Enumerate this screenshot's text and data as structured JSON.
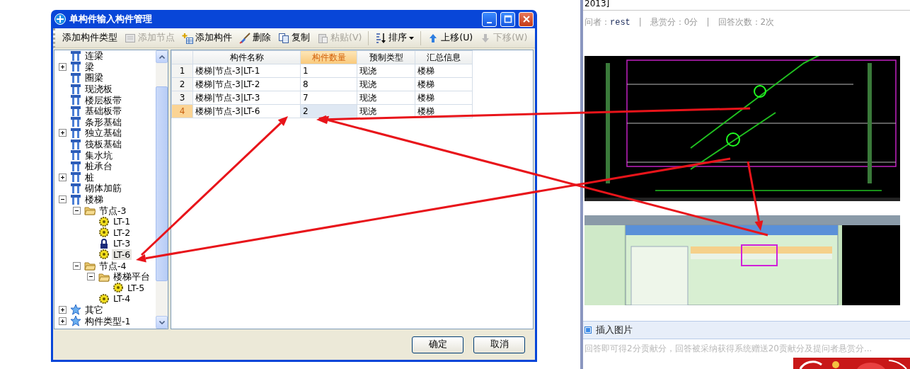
{
  "dialog": {
    "title": "单构件输入构件管理",
    "window_buttons": [
      {
        "kind": "minimize"
      },
      {
        "kind": "maximize"
      },
      {
        "kind": "close"
      }
    ],
    "toolbar": [
      {
        "kind": "plain",
        "label": "添加构件类型",
        "disabled": false
      },
      {
        "kind": "node",
        "label": "添加节点",
        "disabled": true
      },
      {
        "kind": "add",
        "label": "添加构件",
        "disabled": false
      },
      {
        "kind": "delete",
        "label": "删除",
        "disabled": false
      },
      {
        "kind": "copy",
        "label": "复制",
        "disabled": false
      },
      {
        "kind": "paste",
        "label": "粘贴(V)",
        "disabled": true
      },
      {
        "kind": "separator"
      },
      {
        "kind": "sort",
        "label": "排序",
        "disabled": false
      },
      {
        "kind": "separator"
      },
      {
        "kind": "up",
        "label": "上移(U)",
        "disabled": false
      },
      {
        "kind": "down",
        "label": "下移(W)",
        "disabled": true
      }
    ],
    "tree": {
      "items": [
        {
          "kind": "category",
          "label": "连梁",
          "selected": false
        },
        {
          "kind": "category",
          "label": "梁",
          "selected": false,
          "expanded": false
        },
        {
          "kind": "category",
          "label": "圈梁",
          "selected": false
        },
        {
          "kind": "category",
          "label": "现浇板",
          "selected": false
        },
        {
          "kind": "category",
          "label": "楼层板带",
          "selected": false
        },
        {
          "kind": "category",
          "label": "基础板带",
          "selected": false
        },
        {
          "kind": "category",
          "label": "条形基础",
          "selected": false
        },
        {
          "kind": "category",
          "label": "独立基础",
          "selected": false,
          "expanded": false
        },
        {
          "kind": "category",
          "label": "筏板基础",
          "selected": false
        },
        {
          "kind": "category",
          "label": "集水坑",
          "selected": false
        },
        {
          "kind": "category",
          "label": "桩承台",
          "selected": false
        },
        {
          "kind": "category",
          "label": "桩",
          "selected": false,
          "expanded": false
        },
        {
          "kind": "category",
          "label": "砌体加筋",
          "selected": false
        },
        {
          "kind": "category",
          "label": "楼梯",
          "selected": false,
          "expanded": true,
          "children": [
            {
              "kind": "folder",
              "label": "节点-3",
              "selected": false,
              "expanded": true,
              "children": [
                {
                  "kind": "member",
                  "label": "LT-1",
                  "selected": false
                },
                {
                  "kind": "member",
                  "label": "LT-2",
                  "selected": false
                },
                {
                  "kind": "locked",
                  "label": "LT-3",
                  "selected": false
                },
                {
                  "kind": "member",
                  "label": "LT-6",
                  "selected": true
                }
              ]
            },
            {
              "kind": "folder",
              "label": "节点-4",
              "selected": false,
              "expanded": true,
              "children": [
                {
                  "kind": "folder",
                  "label": "楼梯平台",
                  "selected": false,
                  "expanded": true,
                  "children": [
                    {
                      "kind": "member",
                      "label": "LT-5",
                      "selected": false
                    }
                  ]
                },
                {
                  "kind": "member",
                  "label": "LT-4",
                  "selected": false
                }
              ]
            }
          ]
        },
        {
          "kind": "group",
          "label": "其它",
          "selected": false,
          "expanded": false
        },
        {
          "kind": "group",
          "label": "构件类型-1",
          "selected": false,
          "expanded": false
        }
      ]
    },
    "table": {
      "columns": [
        {
          "label": "构件名称",
          "selected": false
        },
        {
          "label": "构件数量",
          "selected": true
        },
        {
          "label": "预制类型",
          "selected": false
        },
        {
          "label": "汇总信息",
          "selected": false
        }
      ],
      "rows": [
        {
          "number": "1",
          "selected": false,
          "cells": [
            {
              "text": "楼梯|节点-3|LT-1",
              "selected": false
            },
            {
              "text": "1",
              "selected": false
            },
            {
              "text": "现浇",
              "selected": false
            },
            {
              "text": "楼梯",
              "selected": false
            }
          ]
        },
        {
          "number": "2",
          "selected": false,
          "cells": [
            {
              "text": "楼梯|节点-3|LT-2",
              "selected": false
            },
            {
              "text": "8",
              "selected": false
            },
            {
              "text": "现浇",
              "selected": false
            },
            {
              "text": "楼梯",
              "selected": false
            }
          ]
        },
        {
          "number": "3",
          "selected": false,
          "cells": [
            {
              "text": "楼梯|节点-3|LT-3",
              "selected": false
            },
            {
              "text": "7",
              "selected": false
            },
            {
              "text": "现浇",
              "selected": false
            },
            {
              "text": "楼梯",
              "selected": false
            }
          ]
        },
        {
          "number": "4",
          "selected": true,
          "cells": [
            {
              "text": "楼梯|节点-3|LT-6",
              "selected": false
            },
            {
              "text": "2",
              "selected": true
            },
            {
              "text": "现浇",
              "selected": false
            },
            {
              "text": "楼梯",
              "selected": false
            }
          ]
        }
      ]
    },
    "buttons": [
      "确定",
      "取消"
    ]
  },
  "question": {
    "fragment": "2013]",
    "meta": [
      {
        "kind": "user",
        "label": "问者：",
        "value": "rest"
      },
      {
        "kind": "separator",
        "text": "|"
      },
      {
        "kind": "field",
        "text": "悬赏分：0分"
      },
      {
        "kind": "separator",
        "text": "|"
      },
      {
        "kind": "field",
        "text": "回答次数：2次"
      }
    ],
    "insert_image": "插入图片",
    "answer_box": {
      "placeholder": "回答即可得2分贡献分，回答被采纳获得系统赠送20贡献分及提问者悬赏分..."
    }
  }
}
